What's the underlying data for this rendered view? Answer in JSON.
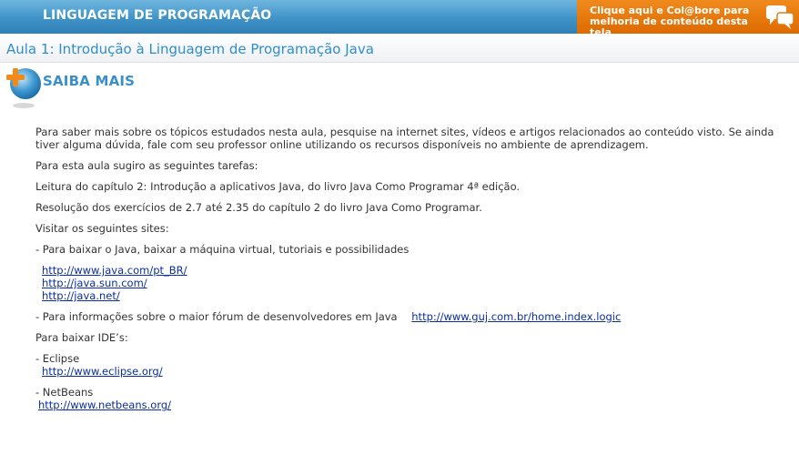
{
  "header": {
    "title": "LINGUAGEM DE PROGRAMAÇÃO",
    "collab_line1": "Clique aqui e Col@bore para",
    "collab_line2": "melhoria de conteúdo desta tela",
    "collab_icon": "speech-bubbles-icon"
  },
  "lesson": {
    "title": "Aula 1: Introdução à Linguagem de Programação Java"
  },
  "section": {
    "label": "SAIBA MAIS",
    "icon": "plus-globe-icon"
  },
  "content": {
    "intro": "Para saber mais sobre os tópicos estudados nesta aula, pesquise na internet sites, vídeos e artigos relacionados ao conteúdo visto. Se ainda tiver alguma dúvida, fale com seu professor online utilizando os recursos disponíveis no ambiente de aprendizagem.",
    "tasks_intro": "Para esta aula sugiro as seguintes tarefas:",
    "task1": "Leitura do capítulo 2: Introdução a aplicativos Java, do livro Java Como Programar 4ª edição.",
    "task2": "Resolução dos exercícios de 2.7 até 2.35 do capítulo 2 do livro Java Como Programar.",
    "visit": "Visitar os seguintes sites:",
    "java_download": "- Para baixar o Java, baixar a máquina virtual, tutoriais e possibilidades",
    "java_links": [
      "http://www.java.com/pt_BR/",
      "http://java.sun.com/",
      "http://java.net/"
    ],
    "forum_text": "- Para informações sobre o maior fórum de desenvolvedores em Java",
    "forum_link": "http://www.guj.com.br/home.index.logic",
    "ide_intro": "Para baixar IDE’s:",
    "eclipse_label": "- Eclipse",
    "eclipse_link": "http://www.eclipse.org/",
    "netbeans_label": "- NetBeans",
    "netbeans_link": "http://www.netbeans.org/"
  },
  "colors": {
    "header_blue": "#3f93c8",
    "collab_orange": "#e67a0c",
    "title_blue": "#2e8ec9",
    "link_blue": "#0a2f9c"
  }
}
